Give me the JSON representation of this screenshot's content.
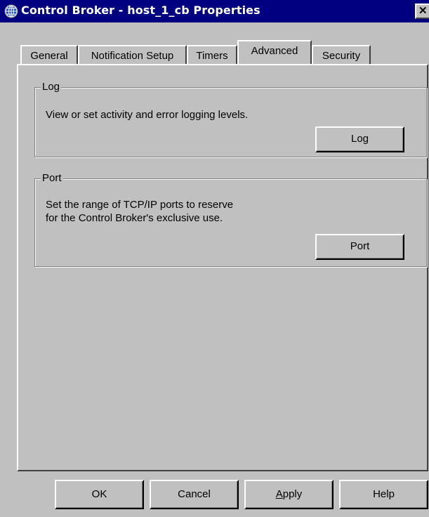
{
  "window": {
    "title": "Control Broker - host_1_cb Properties",
    "close_glyph": "✕"
  },
  "tabs": [
    {
      "label": "General",
      "active": false
    },
    {
      "label": "Notification Setup",
      "active": false
    },
    {
      "label": "Timers",
      "active": false
    },
    {
      "label": "Advanced",
      "active": true
    },
    {
      "label": "Security",
      "active": false
    }
  ],
  "groups": {
    "log": {
      "title": "Log",
      "description": "View or set activity and error logging levels.",
      "button_label": "Log"
    },
    "port": {
      "title": "Port",
      "description_line1": "Set the range of TCP/IP ports to reserve",
      "description_line2": "for the Control Broker's exclusive use.",
      "button_label": "Port"
    }
  },
  "buttons": {
    "ok": "OK",
    "cancel": "Cancel",
    "apply_prefix": "",
    "apply_mnemonic": "A",
    "apply_rest": "pply",
    "help": "Help"
  },
  "colors": {
    "title_bar": "#000080",
    "face": "#c0c0c0"
  },
  "icons": {
    "app": "globe-icon",
    "close": "close-icon"
  }
}
